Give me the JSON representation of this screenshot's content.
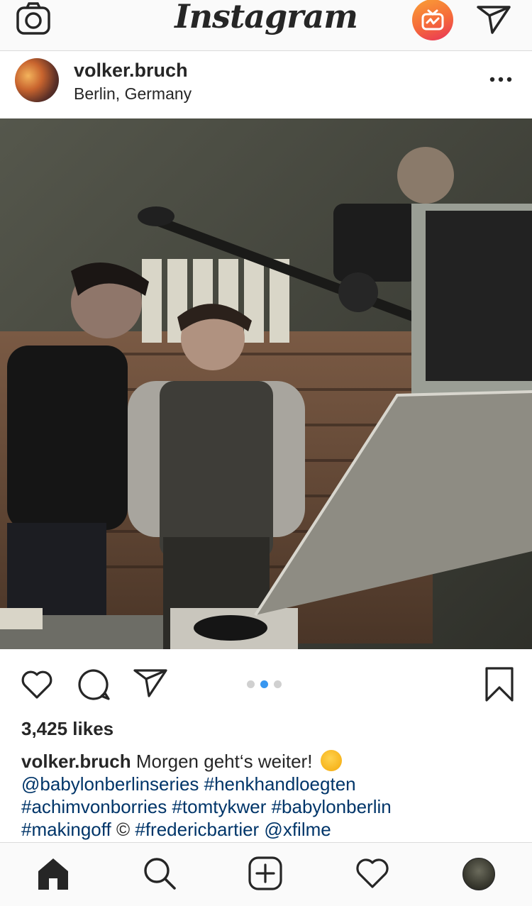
{
  "top_bar": {
    "logo_text": "Instagram",
    "icons": [
      "camera-icon",
      "igtv-icon",
      "direct-send-icon"
    ],
    "igtv_gradient": [
      "#f9a036",
      "#f56a3a",
      "#e8325a"
    ]
  },
  "post": {
    "username": "volker.bruch",
    "location": "Berlin, Germany",
    "carousel": {
      "count": 3,
      "active_index": 1
    },
    "likes": "3,425 likes",
    "caption": {
      "username": "volker.bruch",
      "text": "Morgen geht‘s weiter!",
      "line2": "@babylonberlinseries #henkhandloegten",
      "line3": "#achimvonborries #tomtykwer #babylonberlin",
      "line4_a": "#makingoff",
      "line4_copyright": "©",
      "line4_b": "#fredericbartier @xfilme"
    }
  },
  "tab_bar": {
    "items": [
      "home-icon",
      "search-icon",
      "new-post-icon",
      "activity-icon",
      "profile-icon"
    ]
  },
  "colors": {
    "link": "#003569",
    "carousel_active": "#3897f0",
    "carousel_inactive": "#d0d0d0"
  }
}
